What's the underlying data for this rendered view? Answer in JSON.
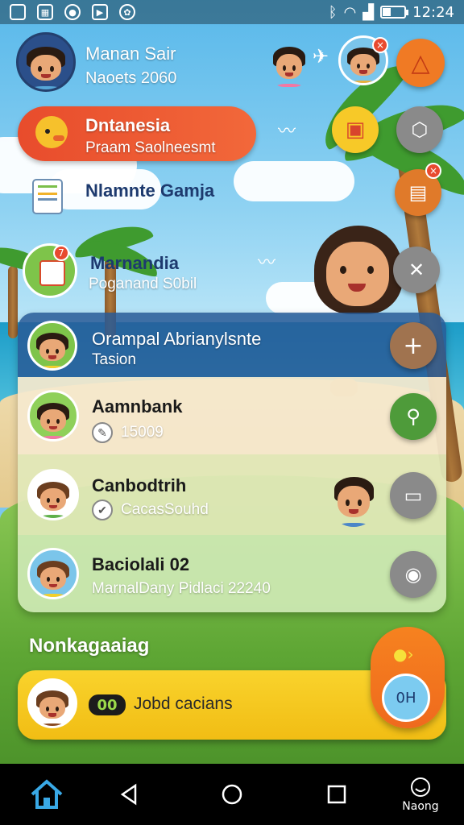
{
  "status_bar": {
    "icons": [
      "screenshot-icon",
      "gallery-icon",
      "app-icon",
      "play-store-icon",
      "settings-icon"
    ],
    "network_icons": [
      "bluetooth-icon",
      "wifi-icon",
      "signal-icon"
    ],
    "battery_level": 0.35,
    "time": "12:24"
  },
  "header": {
    "user_name": "Manan Sair",
    "user_sub": "Naoets 2060",
    "actions": [
      "child-avatar",
      "airplane-icon",
      "friend-avatar",
      "warning-icon"
    ],
    "friend_badge": "×"
  },
  "menu": [
    {
      "title": "Dntanesia",
      "sub": "Praam Saolneesmt",
      "icon": "duck-icon",
      "active": true
    },
    {
      "title": "Nlamnte Gamja",
      "sub": "",
      "icon": "document-icon",
      "active": false
    },
    {
      "title": "Marnandia",
      "sub": "Poganand S0bil",
      "icon": "notes-icon",
      "badge": "7",
      "active": false
    }
  ],
  "side_buttons": [
    {
      "icon": "ticket-icon",
      "color": "#f7c928"
    },
    {
      "icon": "shield-icon",
      "color": "#8a8a8a"
    },
    {
      "icon": "wallet-icon",
      "color": "#e07a2a",
      "badge": "×"
    },
    {
      "icon": "tools-icon",
      "color": "#8a8a8a"
    }
  ],
  "list": [
    {
      "title": "Orampal Abrianylsnte",
      "sub": "Tasion",
      "action": "plus-icon",
      "action_color": "#a0734f",
      "bg": "#3e6ea0",
      "check": ""
    },
    {
      "title": "Aamnbank",
      "sub": "15009",
      "action": "user-pin-icon",
      "action_color": "#4e9b3a",
      "bg": "#efe2c4",
      "check": "pencil"
    },
    {
      "title": "Canbodtrih",
      "sub": "CacasSouhd",
      "action": "message-icon",
      "action_color": "#8a8a8a",
      "bg": "#dfe6b4",
      "check": "check"
    },
    {
      "title": "Baciolali 02",
      "sub": "MarnalDany  Pidlaci 22240",
      "action": "eye-icon",
      "action_color": "#8a8a8a",
      "bg": "#cfe7b4",
      "check": ""
    }
  ],
  "now_playing": {
    "section_title": "Nonkagaaiag",
    "tag": "00",
    "text": "Jobd cacians",
    "fab_label": "0H"
  },
  "navbar": {
    "items": [
      "home-icon",
      "back-icon",
      "home-circle-icon",
      "recents-icon",
      "smiley-icon"
    ],
    "profile_label": "Naong"
  }
}
